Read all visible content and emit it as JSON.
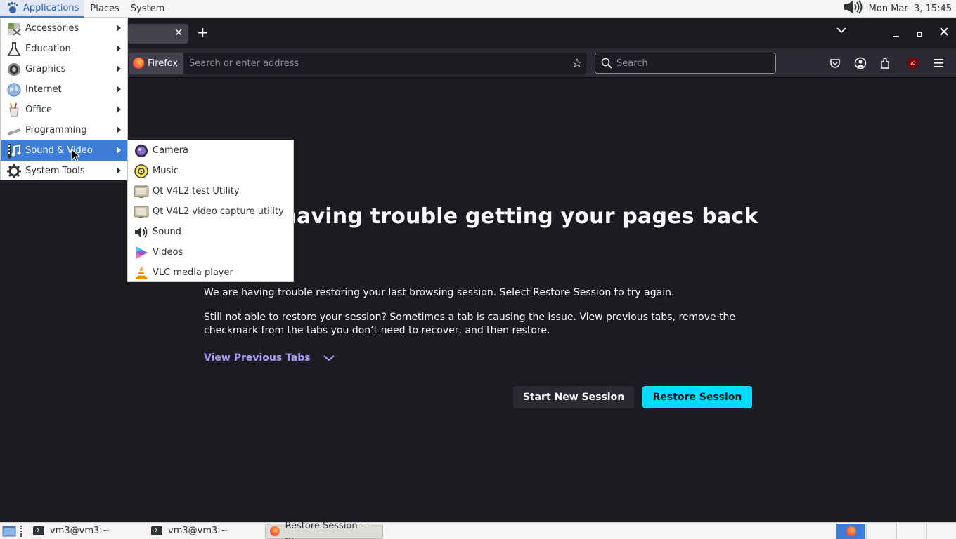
{
  "top_panel": {
    "applications": "Applications",
    "places": "Places",
    "system": "System",
    "clock": "Mon Mar  3, 15:45"
  },
  "browser": {
    "identity_label": "Firefox",
    "url_placeholder": "Search or enter address",
    "search_placeholder": "Search"
  },
  "page": {
    "title": "We’re having trouble getting your pages back",
    "para1": "We are having trouble restoring your last browsing session. Select Restore Session to try again.",
    "para2": "Still not able to restore your session? Sometimes a tab is causing the issue. View previous tabs, remove the checkmark from the tabs you don’t need to recover, and then restore.",
    "view_previous_tabs": "View Previous Tabs",
    "start_new_session_pre": "Start ",
    "start_new_session_u": "N",
    "start_new_session_post": "ew Session",
    "restore_session_u": "R",
    "restore_session_post": "estore Session"
  },
  "apps_menu": {
    "items": [
      {
        "label": "Accessories",
        "icon": "accessories-icon"
      },
      {
        "label": "Education",
        "icon": "education-icon"
      },
      {
        "label": "Graphics",
        "icon": "graphics-icon"
      },
      {
        "label": "Internet",
        "icon": "internet-icon"
      },
      {
        "label": "Office",
        "icon": "office-icon"
      },
      {
        "label": "Programming",
        "icon": "programming-icon"
      },
      {
        "label": "Sound & Video",
        "icon": "sound-video-icon",
        "selected": true
      },
      {
        "label": "System Tools",
        "icon": "system-tools-icon"
      }
    ]
  },
  "sound_video_menu": {
    "items": [
      {
        "label": "Camera",
        "icon": "camera-icon"
      },
      {
        "label": "Music",
        "icon": "music-icon"
      },
      {
        "label": "Qt V4L2 test Utility",
        "icon": "qv4l2-icon"
      },
      {
        "label": "Qt V4L2 video capture utility",
        "icon": "qvidcap-icon"
      },
      {
        "label": "Sound",
        "icon": "sound-icon"
      },
      {
        "label": "Videos",
        "icon": "videos-icon"
      },
      {
        "label": "VLC media player",
        "icon": "vlc-icon"
      }
    ]
  },
  "taskbar": {
    "tasks": [
      {
        "label": "vm3@vm3:~"
      },
      {
        "label": "vm3@vm3:~"
      },
      {
        "label": "Restore Session — ..."
      }
    ]
  }
}
